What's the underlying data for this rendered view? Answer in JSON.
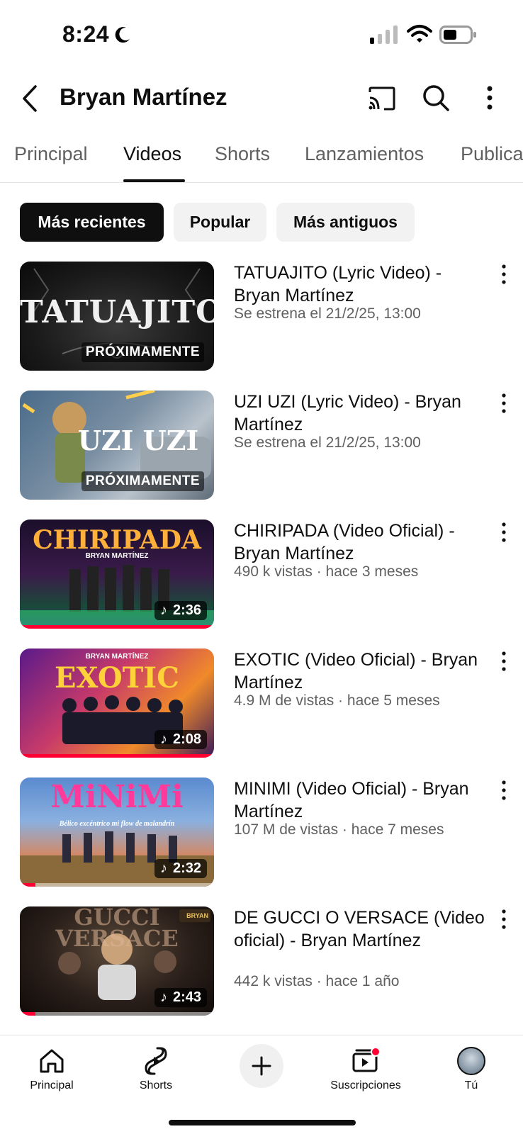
{
  "status": {
    "time": "8:24"
  },
  "header": {
    "title": "Bryan Martínez"
  },
  "tabs": [
    {
      "label": "Principal",
      "active": false
    },
    {
      "label": "Videos",
      "active": true
    },
    {
      "label": "Shorts",
      "active": false
    },
    {
      "label": "Lanzamientos",
      "active": false
    },
    {
      "label": "Publicaciones",
      "active": false
    }
  ],
  "chips": [
    {
      "label": "Más recientes",
      "active": true
    },
    {
      "label": "Popular",
      "active": false
    },
    {
      "label": "Más antiguos",
      "active": false
    }
  ],
  "videos": [
    {
      "title": "TATUAJITO (Lyric Video) - Bryan Martínez",
      "meta": "Se estrena el 21/2/25, 13:00",
      "thumb_text": "TATUAJITO",
      "badge": "PRÓXIMAMENTE",
      "duration": "",
      "watched_fraction": 0
    },
    {
      "title": "UZI UZI (Lyric Video) - Bryan Martínez",
      "meta": "Se estrena el 21/2/25, 13:00",
      "thumb_text": "UZI UZI",
      "badge": "PRÓXIMAMENTE",
      "duration": "",
      "watched_fraction": 0
    },
    {
      "title": "CHIRIPADA (Video Oficial) - Bryan Martínez",
      "meta": "490 k vistas · hace 3 meses",
      "thumb_text": "CHIRIPADA",
      "thumb_sub": "BRYAN MARTÍNEZ",
      "badge": "",
      "duration": "2:36",
      "watched_fraction": 1.0
    },
    {
      "title": "EXOTIC (Video Oficial) - Bryan Martínez",
      "meta": "4.9 M de vistas · hace 5 meses",
      "thumb_text": "EXOTIC",
      "thumb_sub": "BRYAN MARTÍNEZ",
      "badge": "",
      "duration": "2:08",
      "watched_fraction": 1.0
    },
    {
      "title": "MINIMI (Video Oficial) - Bryan Martínez",
      "meta": "107 M de vistas · hace 7 meses",
      "thumb_text": "MiNiMi",
      "thumb_sub": "Bélico excéntrico mi flow de malandrín",
      "badge": "",
      "duration": "2:32",
      "watched_fraction": 0.08
    },
    {
      "title": "DE GUCCI O VERSACE (Video oficial) - Bryan Martínez",
      "meta": "442 k vistas · hace 1 año",
      "thumb_text": "GUCCI VERSACE",
      "thumb_sub": "BRYAN",
      "badge": "",
      "duration": "2:43",
      "watched_fraction": 0.08
    }
  ],
  "bottom_nav": [
    {
      "label": "Principal",
      "icon": "home-icon"
    },
    {
      "label": "Shorts",
      "icon": "shorts-icon"
    },
    {
      "label": "",
      "icon": "create-icon"
    },
    {
      "label": "Suscripciones",
      "icon": "subscriptions-icon"
    },
    {
      "label": "Tú",
      "icon": "avatar"
    }
  ],
  "colors": {
    "accent": "#ff0033",
    "text": "#0f0f0f",
    "secondary": "#606060"
  }
}
